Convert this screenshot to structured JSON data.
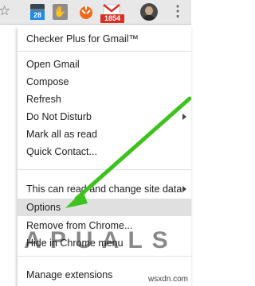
{
  "toolbar": {
    "calendar_badge": "28",
    "gmail_badge": "1854"
  },
  "menu": {
    "items": [
      {
        "label": "Checker Plus for Gmail™"
      },
      {
        "label": "Open Gmail"
      },
      {
        "label": "Compose"
      },
      {
        "label": "Refresh"
      },
      {
        "label": "Do Not Disturb"
      },
      {
        "label": "Mark all as read"
      },
      {
        "label": "Quick Contact..."
      },
      {
        "label": "This can read and change site data"
      },
      {
        "label": "Options"
      },
      {
        "label": "Remove from Chrome..."
      },
      {
        "label": "Hide in Chrome menu"
      },
      {
        "label": "Manage extensions"
      }
    ]
  },
  "watermark": {
    "text": "A P U A L S"
  },
  "site": {
    "text": "wsxdn.com"
  },
  "colors": {
    "arrow": "#3ec21e",
    "badge_red": "#d93025",
    "highlight": "#e0e0e0"
  }
}
